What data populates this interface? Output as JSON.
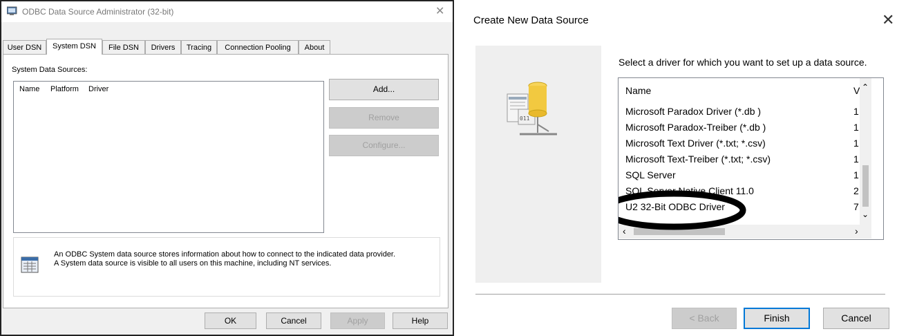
{
  "left": {
    "title": "ODBC Data Source Administrator (32-bit)",
    "close_glyph": "✕",
    "tabs": [
      "User DSN",
      "System DSN",
      "File DSN",
      "Drivers",
      "Tracing",
      "Connection Pooling",
      "About"
    ],
    "active_tab": "System DSN",
    "section_label": "System Data Sources:",
    "columns": [
      "Name",
      "Platform",
      "Driver"
    ],
    "buttons": {
      "add": "Add...",
      "remove": "Remove",
      "configure": "Configure..."
    },
    "info_line1": "An ODBC System data source stores information about how to connect to the indicated data provider.",
    "info_line2": "A System data source is visible to all users on this machine, including NT services.",
    "footer": {
      "ok": "OK",
      "cancel": "Cancel",
      "apply": "Apply",
      "help": "Help"
    }
  },
  "right": {
    "title": "Create New Data Source",
    "close_glyph": "✕",
    "prompt": "Select a driver for which you want to set up a data source.",
    "header_name": "Name",
    "header_version": "V",
    "drivers": [
      {
        "name": "Microsoft Paradox Driver (*.db )",
        "ver": "1"
      },
      {
        "name": "Microsoft Paradox-Treiber (*.db )",
        "ver": "1"
      },
      {
        "name": "Microsoft Text Driver (*.txt; *.csv)",
        "ver": "1"
      },
      {
        "name": "Microsoft Text-Treiber (*.txt; *.csv)",
        "ver": "1"
      },
      {
        "name": "SQL Server",
        "ver": "1"
      },
      {
        "name": "SQL Server Native Client 11.0",
        "ver": "2"
      },
      {
        "name": "U2 32-Bit ODBC Driver",
        "ver": "7"
      }
    ],
    "buttons": {
      "back": "< Back",
      "finish": "Finish",
      "cancel": "Cancel"
    }
  },
  "colors": {
    "highlight_ring": "#000000",
    "finish_border": "#0078d7"
  }
}
